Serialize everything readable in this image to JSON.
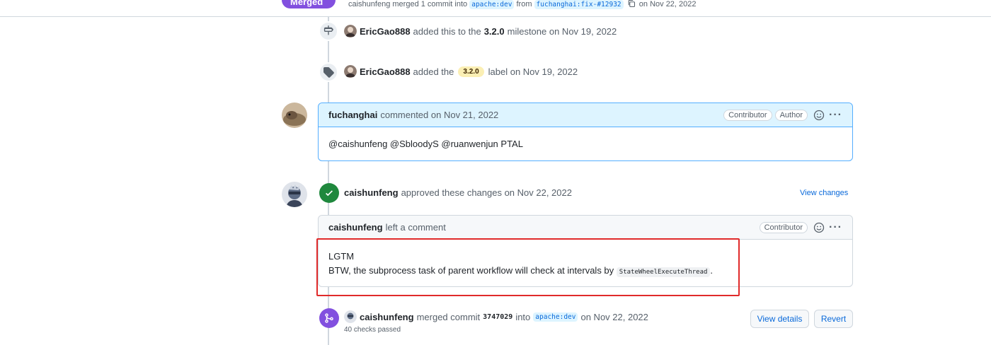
{
  "header": {
    "state_label": "Merged",
    "author": "caishunfeng",
    "merge_text": "merged 1 commit into",
    "base_branch": "apache:dev",
    "from_text": "from",
    "head_branch": "fuchanghai:fix-#12932",
    "date_text": "on Nov 22, 2022"
  },
  "events": [
    {
      "icon": "milestone-icon",
      "actor": "EricGao888",
      "text_before": "added this to the",
      "milestone": "3.2.0",
      "text_after": "milestone on Nov 19, 2022"
    },
    {
      "icon": "tag-icon",
      "actor": "EricGao888",
      "text_before": "added the",
      "label": "3.2.0",
      "text_after": "label on Nov 19, 2022"
    }
  ],
  "comment1": {
    "author": "fuchanghai",
    "meta": "commented on Nov 21, 2022",
    "tags": [
      "Contributor",
      "Author"
    ],
    "body": "@caishunfeng @SbloodyS @ruanwenjun PTAL"
  },
  "review": {
    "author": "caishunfeng",
    "meta": "approved these changes on Nov 22, 2022",
    "view_changes": "View changes",
    "comment_author": "caishunfeng",
    "comment_meta": "left a comment",
    "comment_tag": "Contributor",
    "body_line1": "LGTM",
    "body_line2_before": "BTW, the subprocess task of parent workflow will check at intervals by",
    "body_code": "StateWheelExecuteThread",
    "body_line2_after": "."
  },
  "merge_event": {
    "actor": "caishunfeng",
    "text_before": "merged commit",
    "commit": "3747029",
    "into_text": "into",
    "branch": "apache:dev",
    "date_text": "on Nov 22, 2022",
    "checks": "40 checks passed",
    "view_details": "View details",
    "revert": "Revert"
  },
  "colors": {
    "merged_purple": "#8250df",
    "approved_green": "#1f883d",
    "link_blue": "#0969da",
    "author_comment_border": "#54aeff",
    "author_comment_head_bg": "#ddf4ff",
    "highlight_red": "#e02a2a"
  }
}
